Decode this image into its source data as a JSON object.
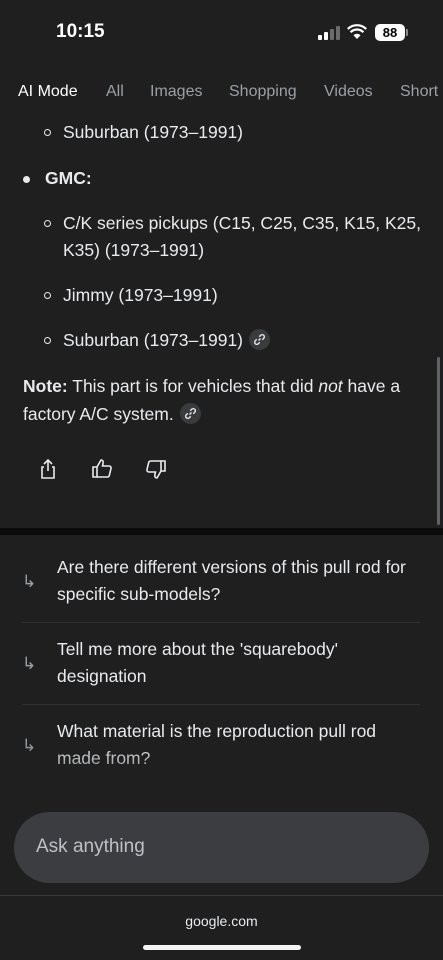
{
  "status": {
    "time": "10:15",
    "battery": "88",
    "icons": [
      "cellular-signal-icon",
      "wifi-icon",
      "battery-icon"
    ]
  },
  "tabs": [
    {
      "label": "AI Mode",
      "active": true
    },
    {
      "label": "All"
    },
    {
      "label": "Images"
    },
    {
      "label": "Shopping"
    },
    {
      "label": "Videos"
    },
    {
      "label": "Short"
    }
  ],
  "answer": {
    "chevy_last_item": "Suburban (1973–1991)",
    "gmc_heading": "GMC:",
    "gmc_items": [
      "C/K series pickups (C15, C25, C35, K15, K25, K35) (1973–1991)",
      "Jimmy (1973–1991)",
      "Suburban (1973–1991)"
    ],
    "note_label": "Note:",
    "note_before": " This part is for vehicles that did ",
    "note_em": "not",
    "note_after": " have a factory A/C system."
  },
  "actions": [
    "share-icon",
    "thumbs-up-icon",
    "thumbs-down-icon"
  ],
  "followups": [
    "Are there different versions of this pull rod for specific sub-models?",
    "Tell me more about the 'squarebody' designation",
    "What material is the reproduction pull rod made from?"
  ],
  "followup_arrow": "↳",
  "ask": {
    "placeholder": "Ask anything"
  },
  "browser": {
    "url": "google.com"
  },
  "colors": {
    "background": "#1f1f1f",
    "text": "#e8eaed",
    "muted": "#9aa0a6",
    "input": "#3c3d40"
  }
}
